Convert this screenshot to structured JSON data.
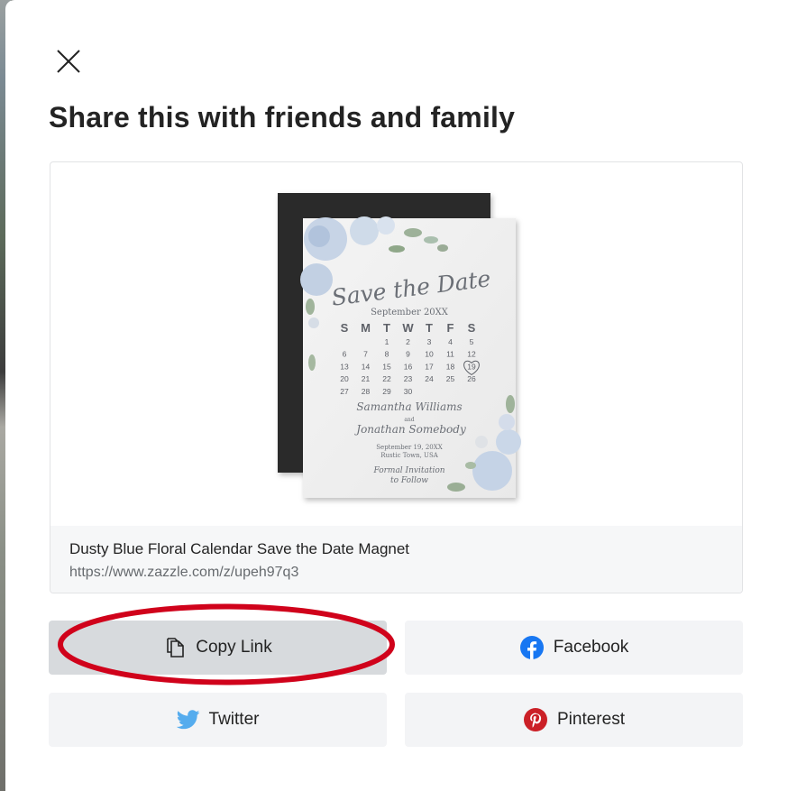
{
  "dialog": {
    "title": "Share this with friends and family",
    "close_icon": "close-icon"
  },
  "product": {
    "name": "Dusty Blue Floral Calendar Save the Date Magnet",
    "url": "https://www.zazzle.com/z/upeh97q3",
    "artwork": {
      "heading": "Save the Date",
      "month": "September 20XX",
      "weekdays": [
        "S",
        "M",
        "T",
        "W",
        "T",
        "F",
        "S"
      ],
      "weeks": [
        [
          "",
          "",
          "1",
          "2",
          "3",
          "4",
          "5"
        ],
        [
          "6",
          "7",
          "8",
          "9",
          "10",
          "11",
          "12"
        ],
        [
          "13",
          "14",
          "15",
          "16",
          "17",
          "18",
          "19"
        ],
        [
          "20",
          "21",
          "22",
          "23",
          "24",
          "25",
          "26"
        ],
        [
          "27",
          "28",
          "29",
          "30",
          "",
          "",
          ""
        ]
      ],
      "highlighted_day": "19",
      "name_1": "Samantha Williams",
      "joiner": "and",
      "name_2": "Jonathan Somebody",
      "date_line": "September 19, 20XX",
      "location_line": "Rustic Town, USA",
      "note_line_1": "Formal Invitation",
      "note_line_2": "to Follow"
    }
  },
  "share_buttons": [
    {
      "label": "Copy Link",
      "icon": "copy-link-icon",
      "active": true
    },
    {
      "label": "Facebook",
      "icon": "facebook-icon",
      "color": "#1877f2"
    },
    {
      "label": "Twitter",
      "icon": "twitter-icon",
      "color": "#55acee"
    },
    {
      "label": "Pinterest",
      "icon": "pinterest-icon",
      "color": "#cb2027"
    }
  ],
  "annotation": {
    "color": "#d0021b",
    "target": "Copy Link"
  }
}
